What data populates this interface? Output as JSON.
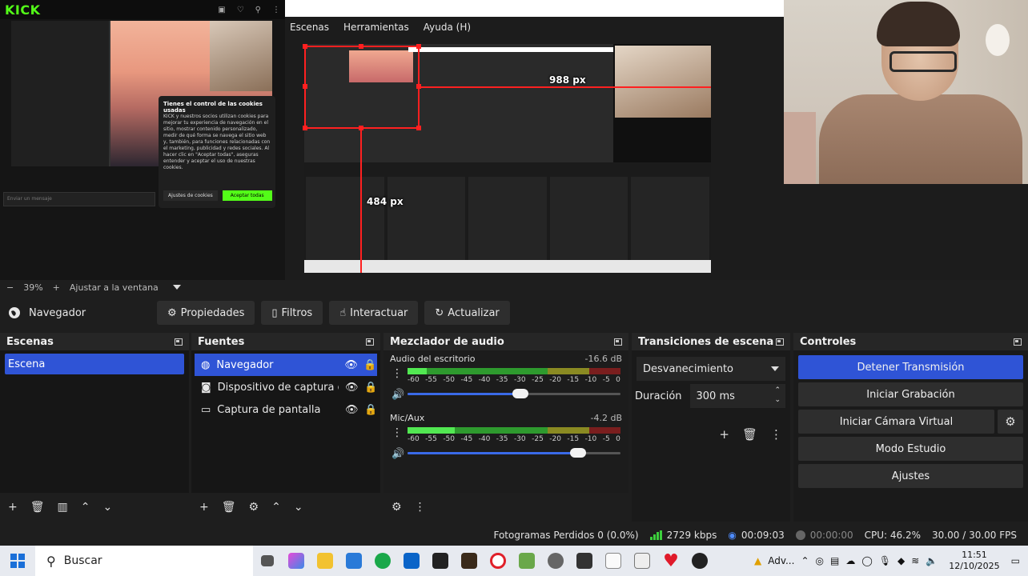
{
  "preview": {
    "mini_kick_logo": "KICK",
    "cookie_title": "Tienes el control de las cookies usadas",
    "cookie_text": "KICK y nuestros socios utilizan cookies para mejorar tu experiencia de navegación en el sitio, mostrar contenido personalizado, medir de qué forma se navega el sitio web y, también, para funciones relacionadas con el marketing, publicidad y redes sociales. Al hacer clic en \"Aceptar todas\", aseguras entender y aceptar el uso de nuestras cookies.",
    "cookie_settings": "Ajustes de cookies",
    "cookie_accept": "Aceptar todas",
    "chat_input_placeholder": "Enviar un mensaje",
    "obs_menu": [
      "Escenas",
      "Herramientas",
      "Ayuda (H)"
    ],
    "px_label_right": "988 px",
    "px_label_bottom": "484 px"
  },
  "zoom": {
    "minus": "−",
    "value": "39%",
    "plus": "+",
    "fit": "Ajustar a la ventana"
  },
  "source_toolbar": {
    "source_name": "Navegador",
    "properties": "Propiedades",
    "filters": "Filtros",
    "interact": "Interactuar",
    "refresh": "Actualizar"
  },
  "scenes": {
    "title": "Escenas",
    "items": [
      "Escena"
    ]
  },
  "sources": {
    "title": "Fuentes",
    "items": [
      {
        "name": "Navegador",
        "icon": "globe-icon",
        "selected": true
      },
      {
        "name": "Dispositivo de captura de v",
        "icon": "camera-icon",
        "selected": false
      },
      {
        "name": "Captura de pantalla",
        "icon": "monitor-icon",
        "selected": false
      }
    ]
  },
  "mixer": {
    "title": "Mezclador de audio",
    "ticks": [
      "-60",
      "-55",
      "-50",
      "-45",
      "-40",
      "-35",
      "-30",
      "-25",
      "-20",
      "-15",
      "-10",
      "-5",
      "0"
    ],
    "channels": [
      {
        "name": "Audio del escritorio",
        "db": "-16.6 dB",
        "level": 0.09,
        "volume": 0.53
      },
      {
        "name": "Mic/Aux",
        "db": "-4.2 dB",
        "level": 0.22,
        "volume": 0.8
      }
    ]
  },
  "transitions": {
    "title": "Transiciones de escena",
    "selected": "Desvanecimiento",
    "duration_label": "Duración",
    "duration_value": "300 ms"
  },
  "controls": {
    "title": "Controles",
    "stop_stream": "Detener Transmisión",
    "start_recording": "Iniciar Grabación",
    "virtual_cam": "Iniciar Cámara Virtual",
    "studio_mode": "Modo Estudio",
    "settings": "Ajustes"
  },
  "status": {
    "dropped": "Fotogramas Perdidos 0 (0.0%)",
    "bitrate": "2729 kbps",
    "stream_time": "00:09:03",
    "record_time": "00:00:00",
    "cpu": "CPU: 46.2%",
    "fps": "30.00 / 30.00 FPS"
  },
  "taskbar": {
    "search": "Buscar",
    "tray_label": "Adv...",
    "time": "11:51",
    "date": "12/10/2025"
  },
  "colors": {
    "accent": "#2f54d6",
    "kick_green": "#53fc18",
    "meter_green": "#3ccf3c",
    "meter_yellow": "#9a9a28",
    "meter_red": "#8a2020"
  }
}
